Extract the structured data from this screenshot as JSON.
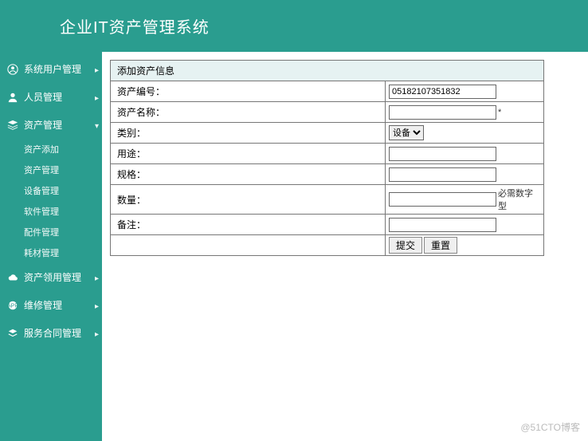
{
  "header": {
    "title": "企业IT资产管理系统"
  },
  "sidebar": {
    "items": [
      {
        "label": "系统用户管理",
        "icon": "user-circle-icon",
        "expanded": false
      },
      {
        "label": "人员管理",
        "icon": "person-icon",
        "expanded": false
      },
      {
        "label": "资产管理",
        "icon": "stack-icon",
        "expanded": true,
        "children": [
          {
            "label": "资产添加"
          },
          {
            "label": "资产管理"
          },
          {
            "label": "设备管理"
          },
          {
            "label": "软件管理"
          },
          {
            "label": "配件管理"
          },
          {
            "label": "耗材管理"
          }
        ]
      },
      {
        "label": "资产领用管理",
        "icon": "cloud-icon",
        "expanded": false
      },
      {
        "label": "维修管理",
        "icon": "badge-icon",
        "expanded": false
      },
      {
        "label": "服务合同管理",
        "icon": "layer-icon",
        "expanded": false
      }
    ]
  },
  "form": {
    "title": "添加资产信息",
    "fields": {
      "asset_no": {
        "label": "资产编号：",
        "value": "05182107351832"
      },
      "asset_name": {
        "label": "资产名称：",
        "value": "",
        "note": "*"
      },
      "category": {
        "label": "类别：",
        "selected": "设备"
      },
      "usage": {
        "label": "用途：",
        "value": ""
      },
      "spec": {
        "label": "规格：",
        "value": ""
      },
      "quantity": {
        "label": "数量：",
        "value": "",
        "note": "必需数字型"
      },
      "remark": {
        "label": "备注：",
        "value": ""
      }
    },
    "buttons": {
      "submit": "提交",
      "reset": "重置"
    }
  },
  "watermark": "@51CTO博客"
}
